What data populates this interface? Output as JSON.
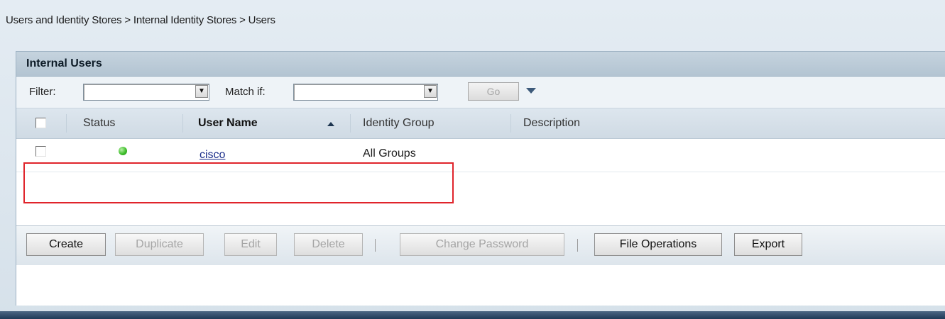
{
  "breadcrumb": "Users and Identity Stores > Internal Identity Stores > Users",
  "panel": {
    "title": "Internal Users"
  },
  "filter_bar": {
    "filter_label": "Filter:",
    "filter_value": "",
    "match_label": "Match if:",
    "match_value": "",
    "go_label": "Go"
  },
  "table": {
    "columns": [
      "Status",
      "User Name",
      "Identity Group",
      "Description"
    ],
    "sorted_column": "User Name",
    "rows": [
      {
        "status": "green",
        "user_name": "cisco",
        "identity_group": "All Groups",
        "description": ""
      }
    ]
  },
  "toolbar": {
    "create": "Create",
    "duplicate": "Duplicate",
    "edit": "Edit",
    "delete": "Delete",
    "change_password": "Change Password",
    "file_operations": "File Operations",
    "export": "Export"
  },
  "colors": {
    "highlight": "#e0242b",
    "status_active": "#3fbf2c",
    "link": "#1a2d8a"
  }
}
